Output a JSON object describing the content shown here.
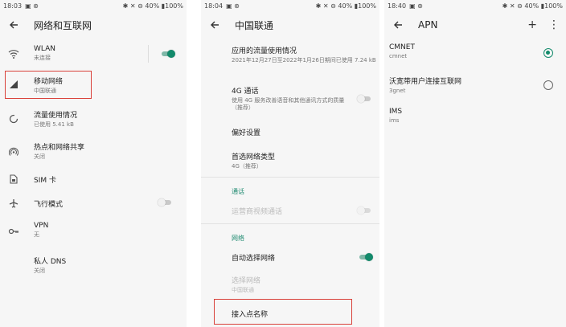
{
  "colors": {
    "accent": "#138a6b",
    "highlight": "#d9413a"
  },
  "panel1": {
    "status": {
      "time": "18:03",
      "right": "✱ ✕ ⊖ 40% ▮100%"
    },
    "title": "网络和互联网",
    "items": [
      {
        "icon": "wifi-icon",
        "title": "WLAN",
        "subtitle": "未连接",
        "toggle": true
      },
      {
        "icon": "signal-icon",
        "title": "移动网络",
        "subtitle": "中国联通"
      },
      {
        "icon": "data-usage-icon",
        "title": "流量使用情况",
        "subtitle": "已使用 5.41 kB"
      },
      {
        "icon": "hotspot-icon",
        "title": "热点和网络共享",
        "subtitle": "关闭"
      },
      {
        "icon": "sim-card-icon",
        "title": "SIM 卡",
        "subtitle": ""
      },
      {
        "icon": "airplane-icon",
        "title": "飞行模式",
        "subtitle": "",
        "toggle": false
      },
      {
        "icon": "vpn-key-icon",
        "title": "VPN",
        "subtitle": "无"
      },
      {
        "icon": "",
        "title": "私人 DNS",
        "subtitle": "关闭"
      }
    ]
  },
  "panel2": {
    "status": {
      "time": "18:04",
      "right": "✱ ✕ ⊖ 40% ▮100%"
    },
    "title": "中国联通",
    "items": {
      "usage": {
        "title": "应用的流量使用情况",
        "subtitle": "2021年12月27日至2022年1月26日期间已使用 7.24 kB"
      },
      "lte": {
        "title": "4G 通话",
        "subtitle": "使用 4G 服务改善语音和其他通讯方式的质量（推荐）",
        "toggle": false
      },
      "prefs": {
        "title": "偏好设置"
      },
      "net_type": {
        "title": "首选网络类型",
        "subtitle": "4G（推荐）"
      },
      "calls_section": "通话",
      "carrier_video": {
        "title": "运营商视频通话",
        "toggle": false
      },
      "network_section": "网络",
      "auto_select": {
        "title": "自动选择网络",
        "toggle": true
      },
      "choose_network": {
        "title": "选择网络",
        "subtitle": "中国联通"
      },
      "apn": {
        "title": "接入点名称"
      }
    }
  },
  "panel3": {
    "status": {
      "time": "18:40",
      "right": "✱ ✕ ⊖ 40% ▮100%"
    },
    "title": "APN",
    "add_label": "+",
    "more_label": "⋮",
    "apns": [
      {
        "title": "CMNET",
        "subtitle": "cmnet",
        "selected": true
      },
      {
        "title": "沃宽带用户连接互联网",
        "subtitle": "3gnet",
        "selected": false
      },
      {
        "title": "IMS",
        "subtitle": "ims"
      }
    ]
  }
}
